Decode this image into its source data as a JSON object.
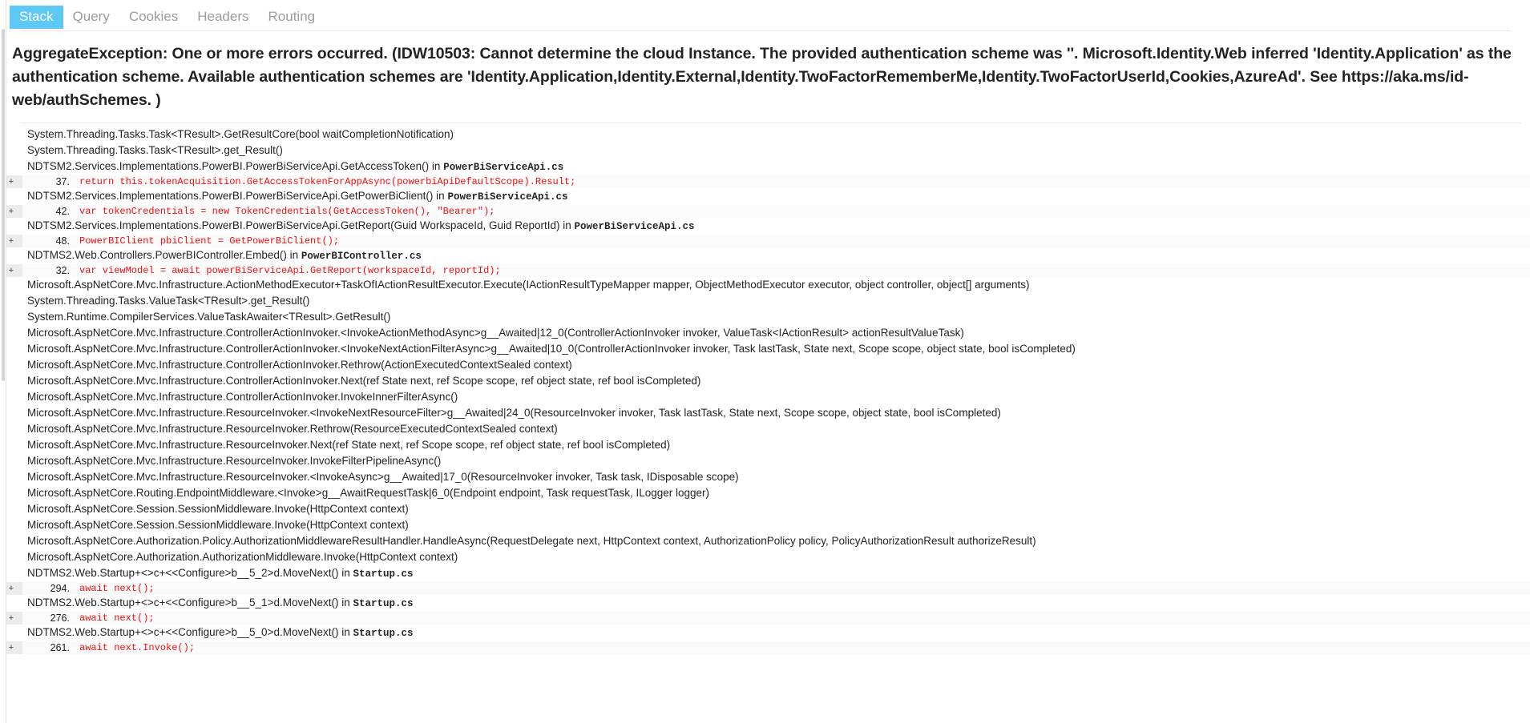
{
  "tabs": [
    {
      "id": "stack",
      "label": "Stack",
      "active": true
    },
    {
      "id": "query",
      "label": "Query",
      "active": false
    },
    {
      "id": "cookies",
      "label": "Cookies",
      "active": false
    },
    {
      "id": "headers",
      "label": "Headers",
      "active": false
    },
    {
      "id": "routing",
      "label": "Routing",
      "active": false
    }
  ],
  "colors": {
    "active_tab_bg": "#5ec8f7",
    "active_tab_text": "#ffffff",
    "tab_text": "#9c9c9c",
    "code_text": "#f01010",
    "code_row_bg": "#fafafa",
    "expander_bg": "#ececec",
    "body_text": "#242424"
  },
  "exception": {
    "headline": "AggregateException: One or more errors occurred. (IDW10503: Cannot determine the cloud Instance. The provided authentication scheme was ''. Microsoft.Identity.Web inferred 'Identity.Application' as the authentication scheme. Available authentication schemes are 'Identity.Application,Identity.External,Identity.TwoFactorRememberMe,Identity.TwoFactorUserId,Cookies,AzureAd'. See https://aka.ms/id-web/authSchemes. )"
  },
  "expander_label": "+",
  "stack": [
    {
      "type": "frame",
      "text": "System.Threading.Tasks.Task<TResult>.GetResultCore(bool waitCompletionNotification)",
      "file": ""
    },
    {
      "type": "frame",
      "text": "System.Threading.Tasks.Task<TResult>.get_Result()",
      "file": ""
    },
    {
      "type": "frame",
      "text": "NDTSM2.Services.Implementations.PowerBI.PowerBiServiceApi.GetAccessToken() in ",
      "file": "PowerBiServiceApi.cs"
    },
    {
      "type": "source",
      "line": "37.",
      "code": "return this.tokenAcquisition.GetAccessTokenForAppAsync(powerbiApiDefaultScope).Result;"
    },
    {
      "type": "frame",
      "text": "NDTSM2.Services.Implementations.PowerBI.PowerBiServiceApi.GetPowerBiClient() in ",
      "file": "PowerBiServiceApi.cs"
    },
    {
      "type": "source",
      "line": "42.",
      "code": "var tokenCredentials = new TokenCredentials(GetAccessToken(), \"Bearer\");"
    },
    {
      "type": "frame",
      "text": "NDTSM2.Services.Implementations.PowerBI.PowerBiServiceApi.GetReport(Guid WorkspaceId, Guid ReportId) in ",
      "file": "PowerBiServiceApi.cs"
    },
    {
      "type": "source",
      "line": "48.",
      "code": "PowerBIClient pbiClient = GetPowerBiClient();"
    },
    {
      "type": "frame",
      "text": "NDTMS2.Web.Controllers.PowerBIController.Embed() in ",
      "file": "PowerBIController.cs"
    },
    {
      "type": "source",
      "line": "32.",
      "code": "var viewModel = await powerBiServiceApi.GetReport(workspaceId, reportId);"
    },
    {
      "type": "frame",
      "text": "Microsoft.AspNetCore.Mvc.Infrastructure.ActionMethodExecutor+TaskOfIActionResultExecutor.Execute(IActionResultTypeMapper mapper, ObjectMethodExecutor executor, object controller, object[] arguments)",
      "file": ""
    },
    {
      "type": "frame",
      "text": "System.Threading.Tasks.ValueTask<TResult>.get_Result()",
      "file": ""
    },
    {
      "type": "frame",
      "text": "System.Runtime.CompilerServices.ValueTaskAwaiter<TResult>.GetResult()",
      "file": ""
    },
    {
      "type": "frame",
      "text": "Microsoft.AspNetCore.Mvc.Infrastructure.ControllerActionInvoker.<InvokeActionMethodAsync>g__Awaited|12_0(ControllerActionInvoker invoker, ValueTask<IActionResult> actionResultValueTask)",
      "file": ""
    },
    {
      "type": "frame",
      "text": "Microsoft.AspNetCore.Mvc.Infrastructure.ControllerActionInvoker.<InvokeNextActionFilterAsync>g__Awaited|10_0(ControllerActionInvoker invoker, Task lastTask, State next, Scope scope, object state, bool isCompleted)",
      "file": ""
    },
    {
      "type": "frame",
      "text": "Microsoft.AspNetCore.Mvc.Infrastructure.ControllerActionInvoker.Rethrow(ActionExecutedContextSealed context)",
      "file": ""
    },
    {
      "type": "frame",
      "text": "Microsoft.AspNetCore.Mvc.Infrastructure.ControllerActionInvoker.Next(ref State next, ref Scope scope, ref object state, ref bool isCompleted)",
      "file": ""
    },
    {
      "type": "frame",
      "text": "Microsoft.AspNetCore.Mvc.Infrastructure.ControllerActionInvoker.InvokeInnerFilterAsync()",
      "file": ""
    },
    {
      "type": "frame",
      "text": "Microsoft.AspNetCore.Mvc.Infrastructure.ResourceInvoker.<InvokeNextResourceFilter>g__Awaited|24_0(ResourceInvoker invoker, Task lastTask, State next, Scope scope, object state, bool isCompleted)",
      "file": ""
    },
    {
      "type": "frame",
      "text": "Microsoft.AspNetCore.Mvc.Infrastructure.ResourceInvoker.Rethrow(ResourceExecutedContextSealed context)",
      "file": ""
    },
    {
      "type": "frame",
      "text": "Microsoft.AspNetCore.Mvc.Infrastructure.ResourceInvoker.Next(ref State next, ref Scope scope, ref object state, ref bool isCompleted)",
      "file": ""
    },
    {
      "type": "frame",
      "text": "Microsoft.AspNetCore.Mvc.Infrastructure.ResourceInvoker.InvokeFilterPipelineAsync()",
      "file": ""
    },
    {
      "type": "frame",
      "text": "Microsoft.AspNetCore.Mvc.Infrastructure.ResourceInvoker.<InvokeAsync>g__Awaited|17_0(ResourceInvoker invoker, Task task, IDisposable scope)",
      "file": ""
    },
    {
      "type": "frame",
      "text": "Microsoft.AspNetCore.Routing.EndpointMiddleware.<Invoke>g__AwaitRequestTask|6_0(Endpoint endpoint, Task requestTask, ILogger logger)",
      "file": ""
    },
    {
      "type": "frame",
      "text": "Microsoft.AspNetCore.Session.SessionMiddleware.Invoke(HttpContext context)",
      "file": ""
    },
    {
      "type": "frame",
      "text": "Microsoft.AspNetCore.Session.SessionMiddleware.Invoke(HttpContext context)",
      "file": ""
    },
    {
      "type": "frame",
      "text": "Microsoft.AspNetCore.Authorization.Policy.AuthorizationMiddlewareResultHandler.HandleAsync(RequestDelegate next, HttpContext context, AuthorizationPolicy policy, PolicyAuthorizationResult authorizeResult)",
      "file": ""
    },
    {
      "type": "frame",
      "text": "Microsoft.AspNetCore.Authorization.AuthorizationMiddleware.Invoke(HttpContext context)",
      "file": ""
    },
    {
      "type": "frame",
      "text": "NDTMS2.Web.Startup+<>c+<<Configure>b__5_2>d.MoveNext() in ",
      "file": "Startup.cs"
    },
    {
      "type": "source",
      "line": "294.",
      "code": "await next();"
    },
    {
      "type": "frame",
      "text": "NDTMS2.Web.Startup+<>c+<<Configure>b__5_1>d.MoveNext() in ",
      "file": "Startup.cs"
    },
    {
      "type": "source",
      "line": "276.",
      "code": "await next();"
    },
    {
      "type": "frame",
      "text": "NDTMS2.Web.Startup+<>c+<<Configure>b__5_0>d.MoveNext() in ",
      "file": "Startup.cs"
    },
    {
      "type": "source",
      "line": "261.",
      "code": "await next.Invoke();"
    }
  ]
}
